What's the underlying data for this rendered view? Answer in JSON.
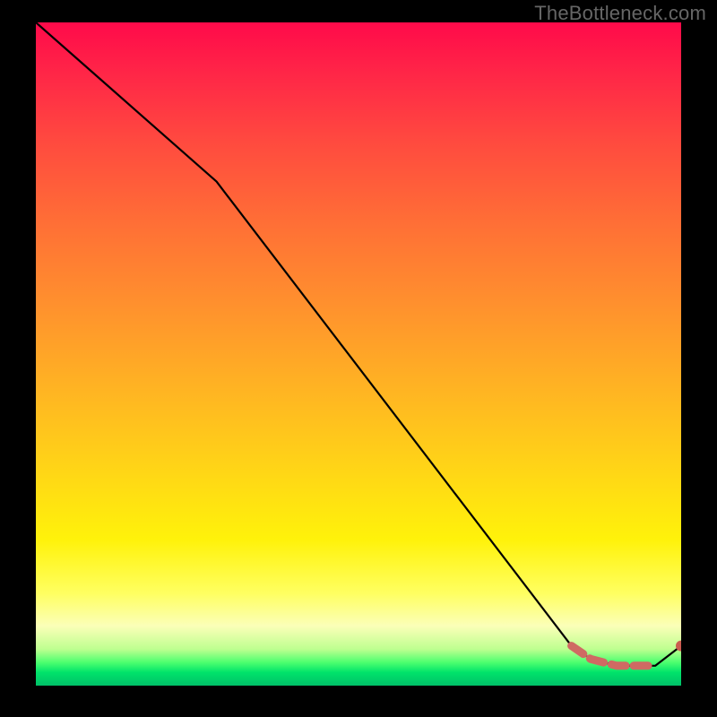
{
  "watermark": "TheBottleneck.com",
  "colors": {
    "line": "#000000",
    "dash": "#cf6a63",
    "endpoint": "#cc5b50",
    "background_black": "#000000"
  },
  "chart_data": {
    "type": "line",
    "title": "",
    "xlabel": "",
    "ylabel": "",
    "xlim": [
      0,
      100
    ],
    "ylim": [
      0,
      100
    ],
    "series": [
      {
        "name": "bottleneck-curve",
        "style": "solid-black",
        "x": [
          0,
          28,
          83,
          86,
          90,
          93,
          96,
          100
        ],
        "y": [
          100,
          76,
          6,
          4,
          3,
          3,
          3,
          6
        ]
      },
      {
        "name": "optimal-region",
        "style": "dashed-thick-red",
        "x": [
          83,
          86,
          90,
          93,
          96
        ],
        "y": [
          6,
          4,
          3,
          3,
          3
        ]
      }
    ],
    "points": [
      {
        "name": "endpoint",
        "x": 100,
        "y": 6
      }
    ],
    "gradient_bands_pct": {
      "red_top": 0,
      "yellow_mid": 78,
      "green_bottom": 98
    }
  }
}
